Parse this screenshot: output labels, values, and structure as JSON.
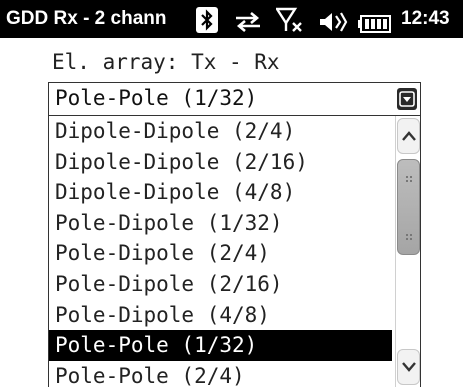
{
  "status_bar": {
    "title": "GDD Rx - 2 chann",
    "time": "12:43",
    "icons": [
      "bluetooth-icon",
      "data-transfer-icon",
      "no-signal-icon",
      "volume-icon",
      "battery-icon"
    ]
  },
  "form": {
    "label": "El. array: Tx - Rx",
    "selected_value": "Pole-Pole (1/32)"
  },
  "dropdown": {
    "options": [
      "Dipole-Dipole (2/4)",
      "Dipole-Dipole (2/16)",
      "Dipole-Dipole (4/8)",
      "Pole-Dipole (1/32)",
      "Pole-Dipole (2/4)",
      "Pole-Dipole (2/16)",
      "Pole-Dipole (4/8)",
      "Pole-Pole (1/32)",
      "Pole-Pole (2/4)"
    ],
    "selected_index": 7
  },
  "colors": {
    "status_bar_bg": "#000000",
    "selection_bg": "#000000",
    "selection_text": "#ffffff"
  }
}
